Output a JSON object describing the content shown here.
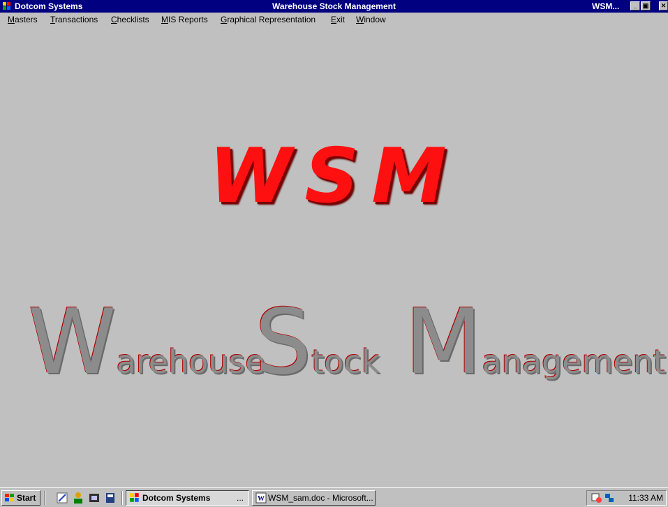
{
  "titlebar": {
    "app_name": "Dotcom Systems",
    "window_title": "Warehouse Stock Management",
    "child_title": "WSM...",
    "minimize_glyph": "_",
    "restore_glyph": "▣",
    "close_glyph": "✕"
  },
  "menu": {
    "items": [
      {
        "mnemonic": "M",
        "rest": "asters"
      },
      {
        "mnemonic": "T",
        "rest": "ransactions"
      },
      {
        "mnemonic": "C",
        "rest": "hecklists"
      },
      {
        "mnemonic": "M",
        "rest": "IS Reports"
      },
      {
        "mnemonic": "G",
        "rest": "raphical Representation"
      },
      {
        "mnemonic": "E",
        "rest": "xit"
      },
      {
        "mnemonic": "W",
        "rest": "indow"
      }
    ]
  },
  "splash": {
    "acronym": "WSM",
    "word1_initial": "W",
    "word1_rest": "arehouse",
    "word2_initial": "S",
    "word2_rest": "tock",
    "word3_initial": "M",
    "word3_rest": "anagement"
  },
  "taskbar": {
    "start_label": "Start",
    "active_task_label": "Dotcom Systems",
    "active_task_ellipsis": "...",
    "task2_label": "WSM_sam.doc - Microsoft...",
    "clock": "11:33 AM"
  },
  "colors": {
    "title_bar": "#000080",
    "desktop": "#c0c0c0",
    "acronym_red": "#ff1010",
    "subtitle_gray": "#8c8c8c"
  }
}
